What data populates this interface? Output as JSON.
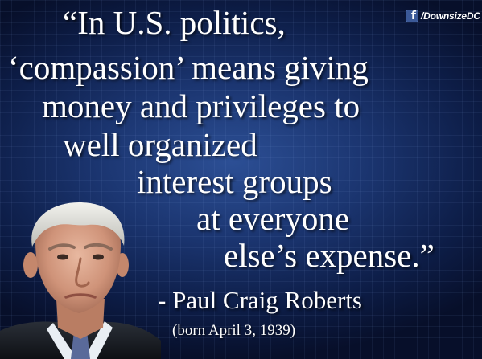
{
  "quote": {
    "lines": [
      "“In U.S. politics,",
      "‘compassion’ means giving",
      "money and privileges to",
      "well organized",
      "interest groups",
      "at everyone",
      "else’s expense.”"
    ]
  },
  "attribution": {
    "author": "- Paul Craig Roberts",
    "born": "(born April 3, 1939)"
  },
  "social": {
    "icon": "facebook-icon",
    "icon_glyph": "f",
    "handle": "/DownsizeDC"
  },
  "colors": {
    "background": "#1b3570",
    "text": "#ffffff",
    "facebook": "#3b5998"
  }
}
